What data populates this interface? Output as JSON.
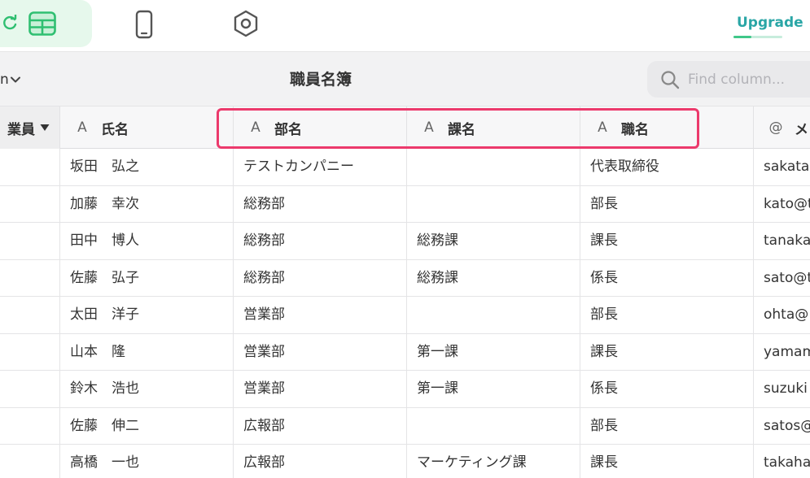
{
  "topbar": {
    "view_icons": [
      "refresh-icon",
      "table-icon",
      "phone-icon",
      "hexagon-settings-icon"
    ],
    "upgrade_label": "Upgrade",
    "accent": "#3fc789"
  },
  "subbar": {
    "view_name": "n",
    "title": "職員名簿",
    "search_placeholder": "Find column..."
  },
  "columns": [
    {
      "label": "業員",
      "icon": "",
      "has_caret": true
    },
    {
      "label": "氏名",
      "icon": "A"
    },
    {
      "label": "部名",
      "icon": "A"
    },
    {
      "label": "課名",
      "icon": "A"
    },
    {
      "label": "職名",
      "icon": "A"
    },
    {
      "label": "メ",
      "icon": "@"
    }
  ],
  "rows": [
    [
      "",
      "坂田　弘之",
      "テストカンパニー",
      "",
      "代表取締役",
      "sakata"
    ],
    [
      "",
      "加藤　幸次",
      "総務部",
      "",
      "部長",
      "kato@t"
    ],
    [
      "",
      "田中　博人",
      "総務部",
      "総務課",
      "課長",
      "tanaka"
    ],
    [
      "",
      "佐藤　弘子",
      "総務部",
      "総務課",
      "係長",
      "sato@t"
    ],
    [
      "",
      "太田　洋子",
      "営業部",
      "",
      "部長",
      "ohta@"
    ],
    [
      "",
      "山本　隆",
      "営業部",
      "第一課",
      "課長",
      "yamam"
    ],
    [
      "",
      "鈴木　浩也",
      "営業部",
      "第一課",
      "係長",
      "suzuki"
    ],
    [
      "",
      "佐藤　伸二",
      "広報部",
      "",
      "部長",
      "satos@"
    ],
    [
      "",
      "高橋　一也",
      "広報部",
      "マーケティング課",
      "課長",
      "takaha"
    ]
  ],
  "highlight_color": "#ec3a6c"
}
